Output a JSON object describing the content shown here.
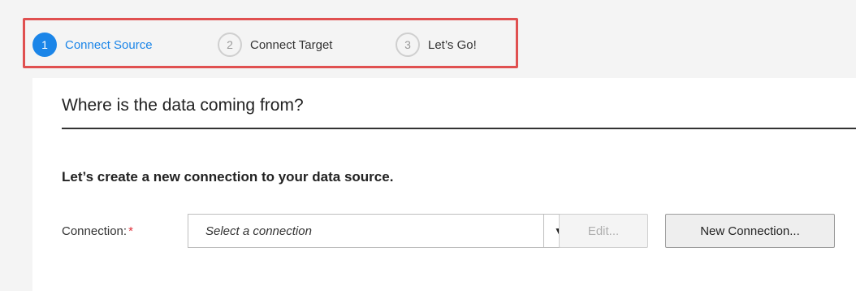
{
  "wizard": {
    "steps": [
      {
        "number": "1",
        "label": "Connect Source",
        "state": "active"
      },
      {
        "number": "2",
        "label": "Connect Target",
        "state": "inactive"
      },
      {
        "number": "3",
        "label": "Let’s Go!",
        "state": "inactive"
      }
    ]
  },
  "main": {
    "title": "Where is the data coming from?",
    "subtitle": "Let’s create a new connection to your data source.",
    "connection": {
      "label": "Connection:",
      "required_marker": "*",
      "placeholder": "Select a connection"
    },
    "buttons": {
      "edit_label": "Edit...",
      "new_label": "New Connection..."
    }
  },
  "colors": {
    "accent": "#1b85e8",
    "highlight_border": "#e05050",
    "required": "#e0313b"
  }
}
